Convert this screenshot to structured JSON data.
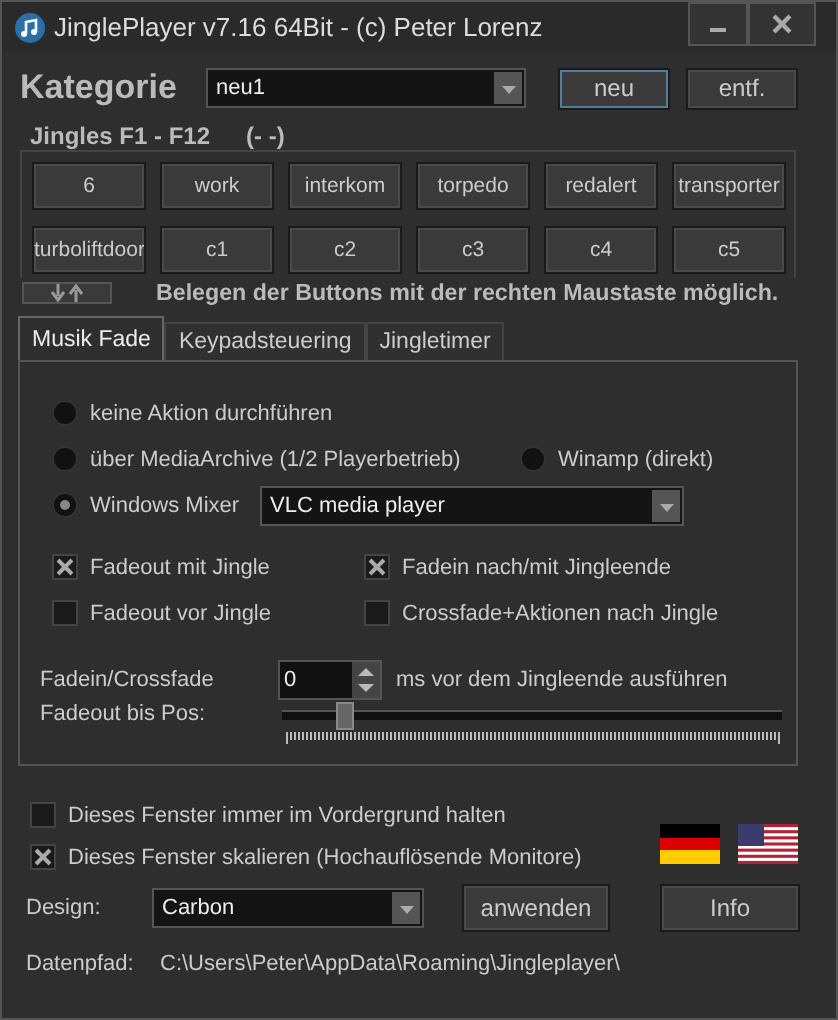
{
  "window": {
    "title": "JinglePlayer v7.16 64Bit - (c) Peter Lorenz"
  },
  "category": {
    "label": "Kategorie",
    "value": "neu1",
    "buttons": [
      {
        "label": "neu",
        "focused": true
      },
      {
        "label": "entf.",
        "focused": false
      }
    ]
  },
  "jingles": {
    "title": "Jingles F1 - F12",
    "status": "(- -)",
    "buttons": [
      "6",
      "work",
      "interkom",
      "torpedo",
      "redalert",
      "transporter",
      "turboliftdoor",
      "c1",
      "c2",
      "c3",
      "c4",
      "c5"
    ],
    "hint": "Belegen der Buttons mit der rechten Maustaste möglich."
  },
  "tabs": [
    {
      "label": "Musik Fade",
      "selected": true
    },
    {
      "label": "Keypadsteuering",
      "selected": false
    },
    {
      "label": "Jingletimer",
      "selected": false
    }
  ],
  "music_fade": {
    "options": [
      {
        "label": "keine Aktion durchführen",
        "selected": false
      },
      {
        "label": "über MediaArchive (1/2 Playerbetrieb)",
        "selected": false
      },
      {
        "label": "Winamp (direkt)",
        "selected": false
      },
      {
        "label": "Windows Mixer",
        "selected": true
      }
    ],
    "mixer_app": "VLC media player",
    "checkboxes": [
      {
        "label": "Fadeout mit Jingle",
        "checked": true
      },
      {
        "label": "Fadein nach/mit Jingleende",
        "checked": true
      },
      {
        "label": "Fadeout vor Jingle",
        "checked": false
      },
      {
        "label": "Crossfade+Aktionen nach Jingle",
        "checked": false
      }
    ],
    "fadein": {
      "label": "Fadein/Crossfade",
      "value": "0",
      "unit": "ms vor dem Jingleende ausführen"
    },
    "fadeout": {
      "label": "Fadeout bis Pos:",
      "level": 0.11
    }
  },
  "settings": {
    "checkboxes": [
      {
        "label": "Dieses Fenster immer im Vordergrund halten",
        "checked": false
      },
      {
        "label": "Dieses Fenster skalieren (Hochauflösende Monitore)",
        "checked": true
      }
    ],
    "design": {
      "label": "Design:",
      "value": "Carbon"
    },
    "apply": "anwenden",
    "info": "Info",
    "path": {
      "label": "Datenpfad:",
      "value": "C:\\Users\\Peter\\AppData\\Roaming\\Jingleplayer\\"
    }
  }
}
